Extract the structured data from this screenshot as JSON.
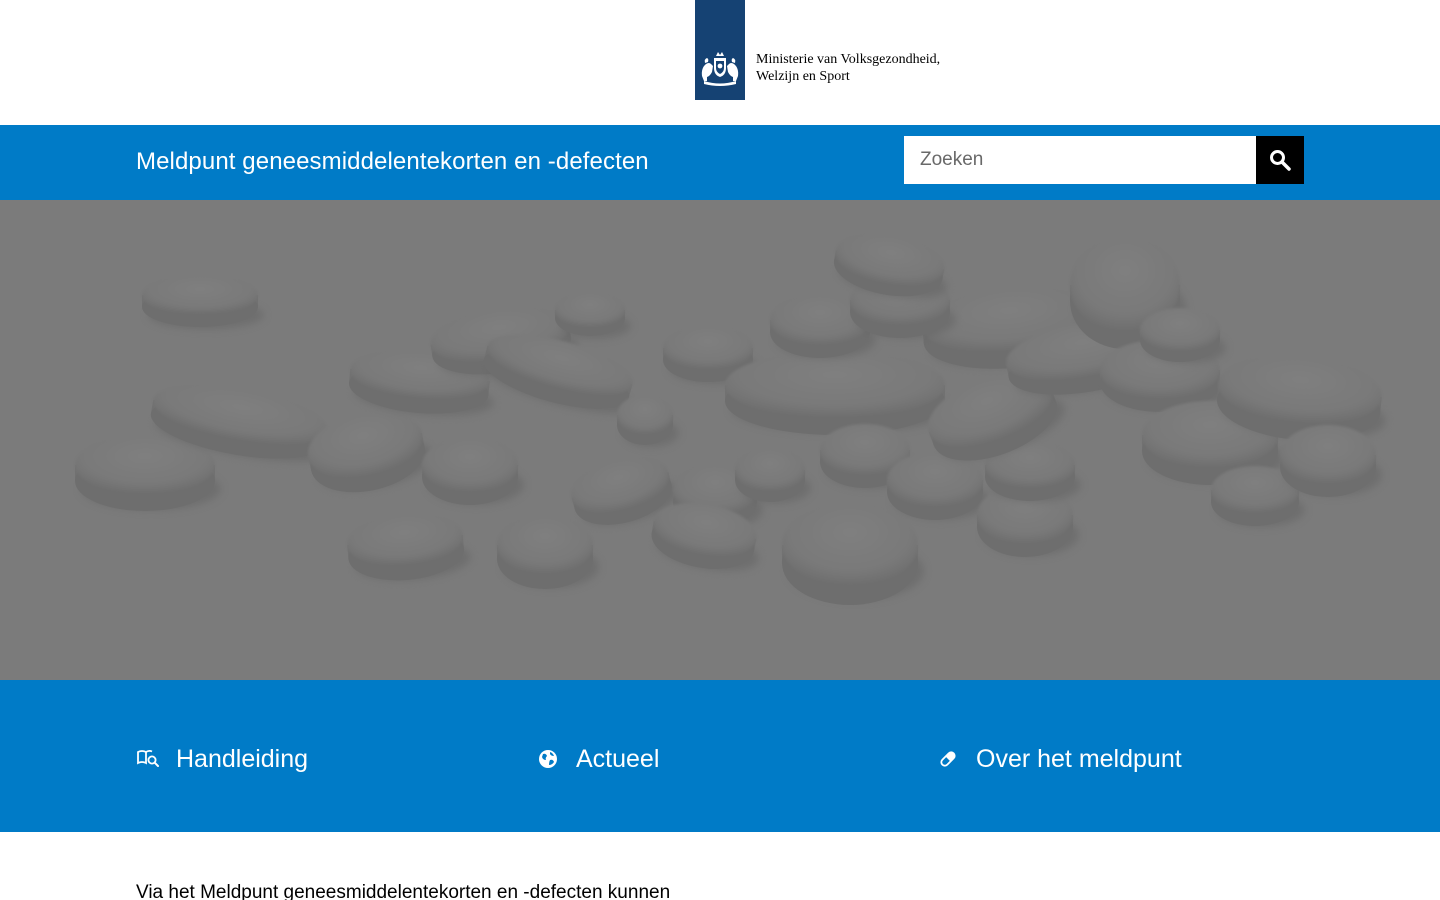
{
  "header": {
    "organisation_line1": "Ministerie van Volksgezondheid,",
    "organisation_line2": "Welzijn en Sport",
    "logo_color": "#154273"
  },
  "sitebar": {
    "title": "Meldpunt geneesmiddelentekorten en -defecten",
    "background_color": "#007bc7",
    "search": {
      "placeholder": "Zoeken",
      "value": "",
      "button_icon": "magnifier-icon"
    }
  },
  "hero": {
    "image": "white-pills-photo"
  },
  "quicklinks": [
    {
      "label": "Handleiding",
      "icon": "book-search-icon"
    },
    {
      "label": "Actueel",
      "icon": "globe-icon"
    },
    {
      "label": "Over het meldpunt",
      "icon": "pill-icon"
    }
  ],
  "main": {
    "intro_text": "Via het Meldpunt geneesmiddelentekorten en -defecten kunnen"
  }
}
